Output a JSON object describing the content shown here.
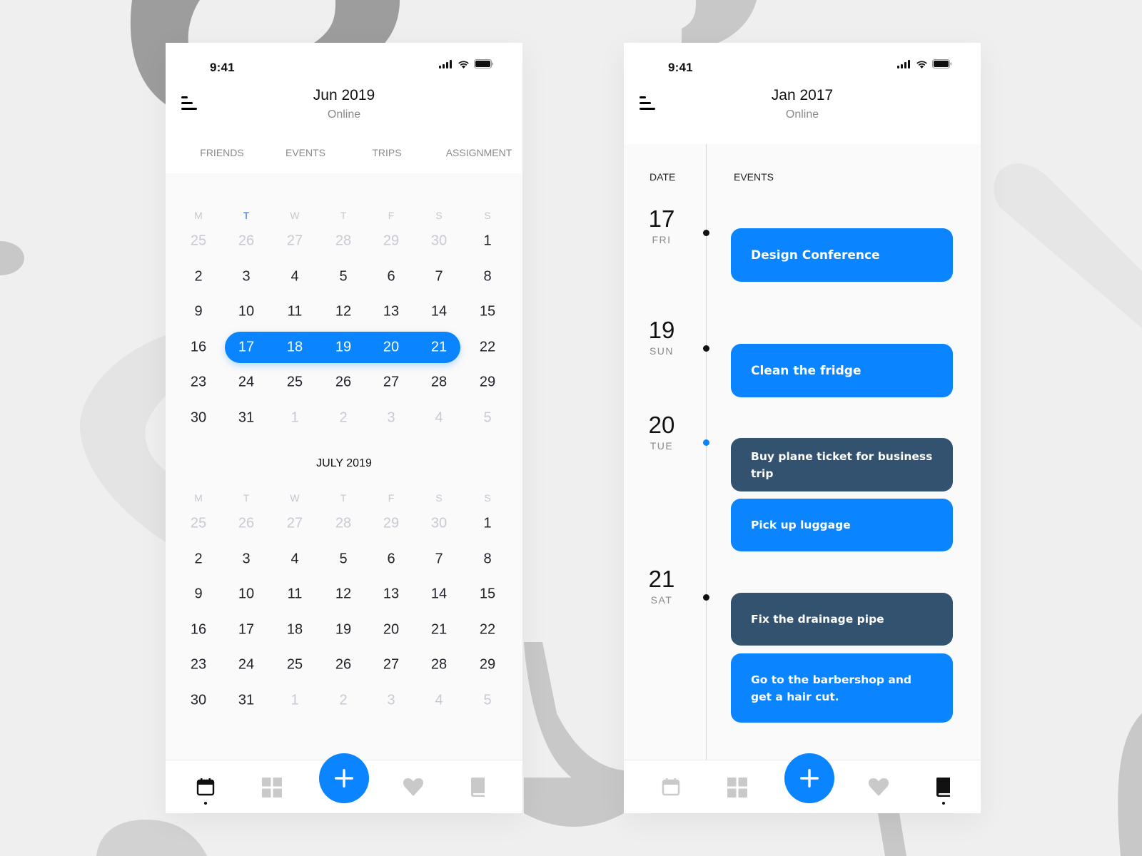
{
  "colors": {
    "accent": "#0a84ff",
    "dark_event": "#33526f",
    "background": "#efefef"
  },
  "phone1": {
    "status_time": "9:41",
    "title": "Jun 2019",
    "subtitle": "Online",
    "tabs": [
      {
        "label": "FRIENDS"
      },
      {
        "label": "EVENTS"
      },
      {
        "label": "TRIPS"
      },
      {
        "label": "ASSIGNMENT"
      }
    ],
    "calendars": [
      {
        "label": "",
        "weekdays": [
          "M",
          "T",
          "W",
          "T",
          "F",
          "S",
          "S"
        ],
        "active_weekday_index": 1,
        "weeks": [
          [
            {
              "d": "25",
              "m": true
            },
            {
              "d": "26",
              "m": true
            },
            {
              "d": "27",
              "m": true
            },
            {
              "d": "28",
              "m": true
            },
            {
              "d": "29",
              "m": true
            },
            {
              "d": "30",
              "m": true
            },
            {
              "d": "1"
            }
          ],
          [
            {
              "d": "2"
            },
            {
              "d": "3"
            },
            {
              "d": "4"
            },
            {
              "d": "5"
            },
            {
              "d": "6"
            },
            {
              "d": "7"
            },
            {
              "d": "8"
            }
          ],
          [
            {
              "d": "9"
            },
            {
              "d": "10"
            },
            {
              "d": "11"
            },
            {
              "d": "12"
            },
            {
              "d": "13"
            },
            {
              "d": "14"
            },
            {
              "d": "15"
            }
          ],
          [
            {
              "d": "16"
            },
            {
              "d": "17",
              "s": true
            },
            {
              "d": "18",
              "s": true
            },
            {
              "d": "19",
              "s": true
            },
            {
              "d": "20",
              "s": true
            },
            {
              "d": "21",
              "s": true
            },
            {
              "d": "22"
            }
          ],
          [
            {
              "d": "23"
            },
            {
              "d": "24"
            },
            {
              "d": "25"
            },
            {
              "d": "26"
            },
            {
              "d": "27"
            },
            {
              "d": "28"
            },
            {
              "d": "29"
            }
          ],
          [
            {
              "d": "30"
            },
            {
              "d": "31"
            },
            {
              "d": "1",
              "m": true
            },
            {
              "d": "2",
              "m": true
            },
            {
              "d": "3",
              "m": true
            },
            {
              "d": "4",
              "m": true
            },
            {
              "d": "5",
              "m": true
            }
          ]
        ],
        "selected_range": {
          "week": 3,
          "from": 1,
          "to": 5
        }
      },
      {
        "label": "JULY 2019",
        "weekdays": [
          "M",
          "T",
          "W",
          "T",
          "F",
          "S",
          "S"
        ],
        "active_weekday_index": -1,
        "weeks": [
          [
            {
              "d": "25",
              "m": true
            },
            {
              "d": "26",
              "m": true
            },
            {
              "d": "27",
              "m": true
            },
            {
              "d": "28",
              "m": true
            },
            {
              "d": "29",
              "m": true
            },
            {
              "d": "30",
              "m": true
            },
            {
              "d": "1"
            }
          ],
          [
            {
              "d": "2"
            },
            {
              "d": "3"
            },
            {
              "d": "4"
            },
            {
              "d": "5"
            },
            {
              "d": "6"
            },
            {
              "d": "7"
            },
            {
              "d": "8"
            }
          ],
          [
            {
              "d": "9"
            },
            {
              "d": "10"
            },
            {
              "d": "11"
            },
            {
              "d": "12"
            },
            {
              "d": "13"
            },
            {
              "d": "14"
            },
            {
              "d": "15"
            }
          ],
          [
            {
              "d": "16"
            },
            {
              "d": "17"
            },
            {
              "d": "18"
            },
            {
              "d": "19"
            },
            {
              "d": "20"
            },
            {
              "d": "21"
            },
            {
              "d": "22"
            }
          ],
          [
            {
              "d": "23"
            },
            {
              "d": "24"
            },
            {
              "d": "25"
            },
            {
              "d": "26"
            },
            {
              "d": "27"
            },
            {
              "d": "28"
            },
            {
              "d": "29"
            }
          ],
          [
            {
              "d": "30"
            },
            {
              "d": "31"
            },
            {
              "d": "1",
              "m": true
            },
            {
              "d": "2",
              "m": true
            },
            {
              "d": "3",
              "m": true
            },
            {
              "d": "4",
              "m": true
            },
            {
              "d": "5",
              "m": true
            }
          ]
        ]
      }
    ],
    "bottom_nav": {
      "active": "calendar",
      "items": [
        "calendar",
        "grid",
        "add",
        "heart",
        "book"
      ]
    }
  },
  "phone2": {
    "status_time": "9:41",
    "title": "Jan 2017",
    "subtitle": "Online",
    "column_headers": {
      "date": "DATE",
      "events": "EVENTS"
    },
    "days": [
      {
        "num": "17",
        "dow": "FRI",
        "dot": "black",
        "events": [
          {
            "title": "Design Conference",
            "style": "blue"
          }
        ]
      },
      {
        "num": "19",
        "dow": "SUN",
        "dot": "black",
        "events": [
          {
            "title": "Clean the fridge",
            "style": "blue"
          }
        ]
      },
      {
        "num": "20",
        "dow": "TUE",
        "dot": "blue",
        "events": [
          {
            "title": "Buy plane ticket for business trip",
            "style": "dark"
          },
          {
            "title": "Pick up luggage",
            "style": "blue"
          }
        ]
      },
      {
        "num": "21",
        "dow": "SAT",
        "dot": "black",
        "events": [
          {
            "title": "Fix the drainage pipe",
            "style": "dark"
          },
          {
            "title": "Go to the barbershop and get a hair cut.",
            "style": "blue"
          }
        ]
      }
    ],
    "bottom_nav": {
      "active": "book",
      "items": [
        "calendar",
        "grid",
        "add",
        "heart",
        "book"
      ]
    }
  }
}
